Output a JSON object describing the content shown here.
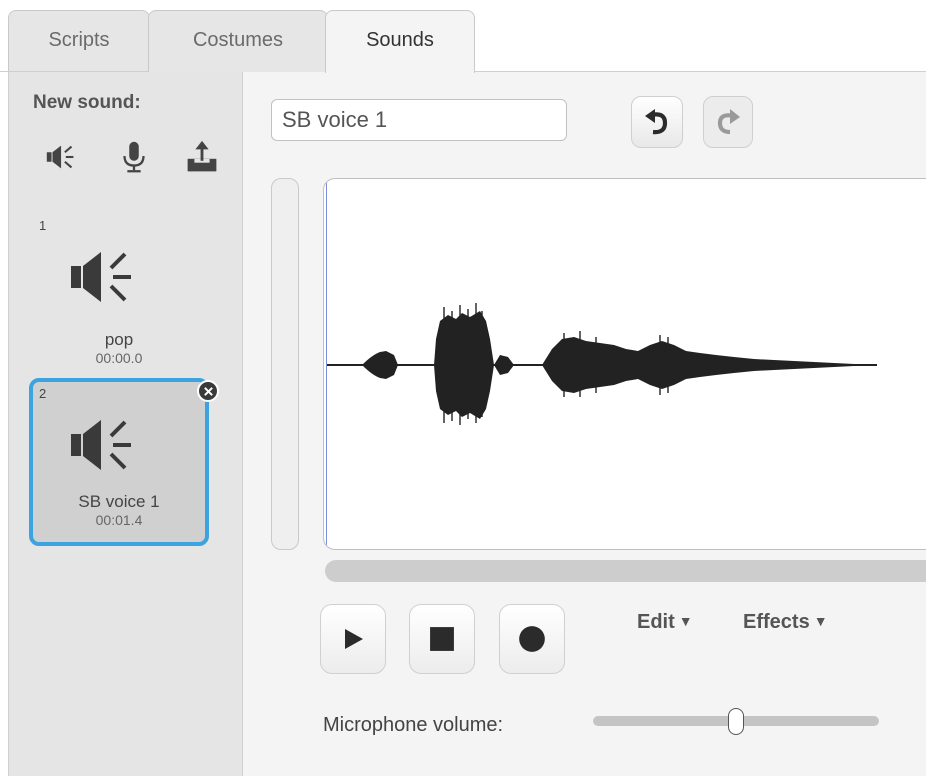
{
  "tabs": [
    {
      "label": "Scripts"
    },
    {
      "label": "Costumes"
    },
    {
      "label": "Sounds"
    }
  ],
  "active_tab": "Sounds",
  "sidebar": {
    "new_sound_label": "New sound:",
    "new_sound_icons": [
      "speaker-library-icon",
      "microphone-icon",
      "upload-icon"
    ],
    "sounds": [
      {
        "number": "1",
        "name": "pop",
        "duration": "00:00.0",
        "selected": false
      },
      {
        "number": "2",
        "name": "SB voice 1",
        "duration": "00:01.4",
        "selected": true
      }
    ]
  },
  "editor": {
    "sound_name": "SB voice 1",
    "undo_icon": "undo-icon",
    "redo_icon": "redo-icon",
    "edit_menu": "Edit",
    "effects_menu": "Effects",
    "menu_arrow": "▼",
    "microphone_label": "Microphone volume:",
    "microphone_level": 0.5
  },
  "colors": {
    "selection_border": "#3aa3e0",
    "waveform": "#222222",
    "playhead": "#7a90d6"
  }
}
